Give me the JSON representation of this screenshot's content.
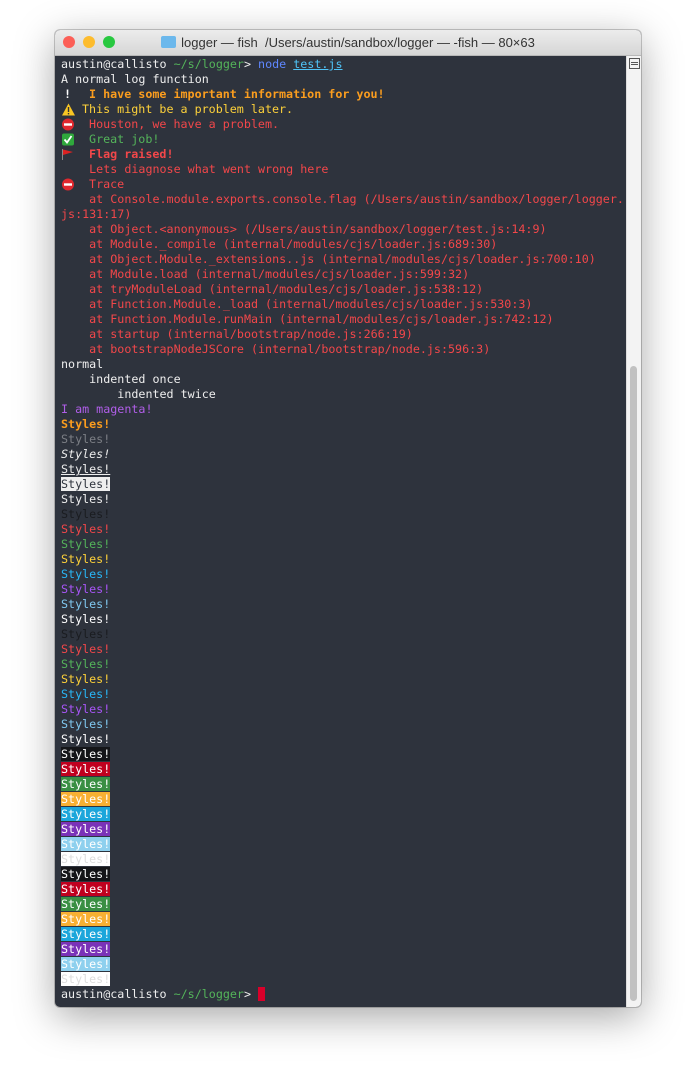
{
  "window": {
    "title": "logger — fish  /Users/austin/sandbox/logger — -fish — 80×63",
    "traffic_lights": {
      "close": "#fc5f57",
      "minimize": "#fdbc2e",
      "zoom": "#28c840"
    }
  },
  "terminal": {
    "background": "#2e333d",
    "lines": [
      {
        "segs": [
          {
            "text": "austin@callisto ",
            "style": "white"
          },
          {
            "text": "~/s/logger",
            "style": "prompt-green"
          },
          {
            "text": "> ",
            "style": "white"
          },
          {
            "text": "node ",
            "style": "blue"
          },
          {
            "text": "test.js",
            "style": "link"
          }
        ]
      },
      {
        "segs": [
          {
            "text": "A normal log function",
            "style": "white"
          }
        ]
      },
      {
        "icon": "exclamation-icon",
        "segs": [
          {
            "text": " I have some important information for you!",
            "style": "orange bold"
          }
        ]
      },
      {
        "icon": "warning-icon",
        "segs": [
          {
            "text": "This might be a problem later.",
            "style": "yellow"
          }
        ]
      },
      {
        "icon": "no-entry-icon",
        "segs": [
          {
            "text": " Houston, we have a problem.",
            "style": "red"
          }
        ]
      },
      {
        "icon": "check-icon",
        "segs": [
          {
            "text": " Great job!",
            "style": "green"
          }
        ]
      },
      {
        "icon": "flag-icon",
        "segs": [
          {
            "text": " Flag raised!",
            "style": "red bold"
          }
        ]
      },
      {
        "segs": [
          {
            "text": "    Lets diagnose what went wrong here",
            "style": "red"
          }
        ]
      },
      {
        "icon": "no-entry-icon",
        "segs": [
          {
            "text": " Trace",
            "style": "red"
          }
        ]
      },
      {
        "segs": [
          {
            "text": "    at Console.module.exports.console.flag (/Users/austin/sandbox/logger/logger.",
            "style": "red"
          }
        ]
      },
      {
        "segs": [
          {
            "text": "js:131:17)",
            "style": "red"
          }
        ]
      },
      {
        "segs": [
          {
            "text": "    at Object.<anonymous> (/Users/austin/sandbox/logger/test.js:14:9)",
            "style": "red"
          }
        ]
      },
      {
        "segs": [
          {
            "text": "    at Module._compile (internal/modules/cjs/loader.js:689:30)",
            "style": "red"
          }
        ]
      },
      {
        "segs": [
          {
            "text": "    at Object.Module._extensions..js (internal/modules/cjs/loader.js:700:10)",
            "style": "red"
          }
        ]
      },
      {
        "segs": [
          {
            "text": "    at Module.load (internal/modules/cjs/loader.js:599:32)",
            "style": "red"
          }
        ]
      },
      {
        "segs": [
          {
            "text": "    at tryModuleLoad (internal/modules/cjs/loader.js:538:12)",
            "style": "red"
          }
        ]
      },
      {
        "segs": [
          {
            "text": "    at Function.Module._load (internal/modules/cjs/loader.js:530:3)",
            "style": "red"
          }
        ]
      },
      {
        "segs": [
          {
            "text": "    at Function.Module.runMain (internal/modules/cjs/loader.js:742:12)",
            "style": "red"
          }
        ]
      },
      {
        "segs": [
          {
            "text": "    at startup (internal/bootstrap/node.js:266:19)",
            "style": "red"
          }
        ]
      },
      {
        "segs": [
          {
            "text": "    at bootstrapNodeJSCore (internal/bootstrap/node.js:596:3)",
            "style": "red"
          }
        ]
      },
      {
        "segs": [
          {
            "text": "normal",
            "style": "white"
          }
        ]
      },
      {
        "segs": [
          {
            "text": "    indented once",
            "style": "white"
          }
        ]
      },
      {
        "segs": [
          {
            "text": "        indented twice",
            "style": "white"
          }
        ]
      },
      {
        "segs": [
          {
            "text": "I am magenta!",
            "style": "magenta"
          }
        ]
      },
      {
        "segs": [
          {
            "text": "Styles!",
            "style": "orange bold"
          }
        ]
      },
      {
        "segs": [
          {
            "text": "Styles!",
            "style": "gray"
          }
        ]
      },
      {
        "segs": [
          {
            "text": "Styles!",
            "style": "white italic"
          }
        ]
      },
      {
        "segs": [
          {
            "text": "Styles!",
            "style": "white underline"
          }
        ]
      },
      {
        "segs": [
          {
            "text": "Styles!",
            "style": "inverse"
          }
        ]
      },
      {
        "segs": [
          {
            "text": "Styles!",
            "style": "white"
          }
        ]
      },
      {
        "segs": [
          {
            "text": "Styles!",
            "style": "black"
          }
        ]
      },
      {
        "segs": [
          {
            "text": "Styles!",
            "style": "red"
          }
        ]
      },
      {
        "segs": [
          {
            "text": "Styles!",
            "style": "green"
          }
        ]
      },
      {
        "segs": [
          {
            "text": "Styles!",
            "style": "yellow"
          }
        ]
      },
      {
        "segs": [
          {
            "text": "Styles!",
            "style": "blue2"
          }
        ]
      },
      {
        "segs": [
          {
            "text": "Styles!",
            "style": "bright-magenta"
          }
        ]
      },
      {
        "segs": [
          {
            "text": "Styles!",
            "style": "cyan"
          }
        ]
      },
      {
        "segs": [
          {
            "text": "Styles!",
            "style": "bright-white"
          }
        ]
      },
      {
        "segs": [
          {
            "text": "Styles!",
            "style": "black"
          }
        ]
      },
      {
        "segs": [
          {
            "text": "Styles!",
            "style": "bright-red"
          }
        ]
      },
      {
        "segs": [
          {
            "text": "Styles!",
            "style": "bright-green"
          }
        ]
      },
      {
        "segs": [
          {
            "text": "Styles!",
            "style": "bright-yellow"
          }
        ]
      },
      {
        "segs": [
          {
            "text": "Styles!",
            "style": "bright-blue"
          }
        ]
      },
      {
        "segs": [
          {
            "text": "Styles!",
            "style": "bright-magenta"
          }
        ]
      },
      {
        "segs": [
          {
            "text": "Styles!",
            "style": "bright-cyan"
          }
        ]
      },
      {
        "segs": [
          {
            "text": "Styles!",
            "style": "bright-white"
          }
        ]
      },
      {
        "segs": [
          {
            "text": "Styles!",
            "style": "bg-black"
          }
        ]
      },
      {
        "segs": [
          {
            "text": "Styles!",
            "style": "bg-red"
          }
        ]
      },
      {
        "segs": [
          {
            "text": "Styles!",
            "style": "bg-green"
          }
        ]
      },
      {
        "segs": [
          {
            "text": "Styles!",
            "style": "bg-yellow"
          }
        ]
      },
      {
        "segs": [
          {
            "text": "Styles!",
            "style": "bg-blue"
          }
        ]
      },
      {
        "segs": [
          {
            "text": "Styles!",
            "style": "bg-magenta"
          }
        ]
      },
      {
        "segs": [
          {
            "text": "Styles!",
            "style": "bg-cyan"
          }
        ]
      },
      {
        "segs": [
          {
            "text": "Styles!",
            "style": "bg-white"
          }
        ]
      },
      {
        "segs": [
          {
            "text": "Styles!",
            "style": "bg-black"
          }
        ]
      },
      {
        "segs": [
          {
            "text": "Styles!",
            "style": "bg-red"
          }
        ]
      },
      {
        "segs": [
          {
            "text": "Styles!",
            "style": "bg-green"
          }
        ]
      },
      {
        "segs": [
          {
            "text": "Styles!",
            "style": "bg-yellow"
          }
        ]
      },
      {
        "segs": [
          {
            "text": "Styles!",
            "style": "bg-blue"
          }
        ]
      },
      {
        "segs": [
          {
            "text": "Styles!",
            "style": "bg-magenta"
          }
        ]
      },
      {
        "segs": [
          {
            "text": "Styles!",
            "style": "bg-cyan"
          }
        ]
      },
      {
        "segs": [
          {
            "text": "Styles!",
            "style": "bg-white"
          }
        ]
      },
      {
        "cursor": true,
        "segs": [
          {
            "text": "austin@callisto ",
            "style": "white"
          },
          {
            "text": "~/s/logger",
            "style": "prompt-green"
          },
          {
            "text": "> ",
            "style": "white"
          }
        ]
      }
    ]
  }
}
